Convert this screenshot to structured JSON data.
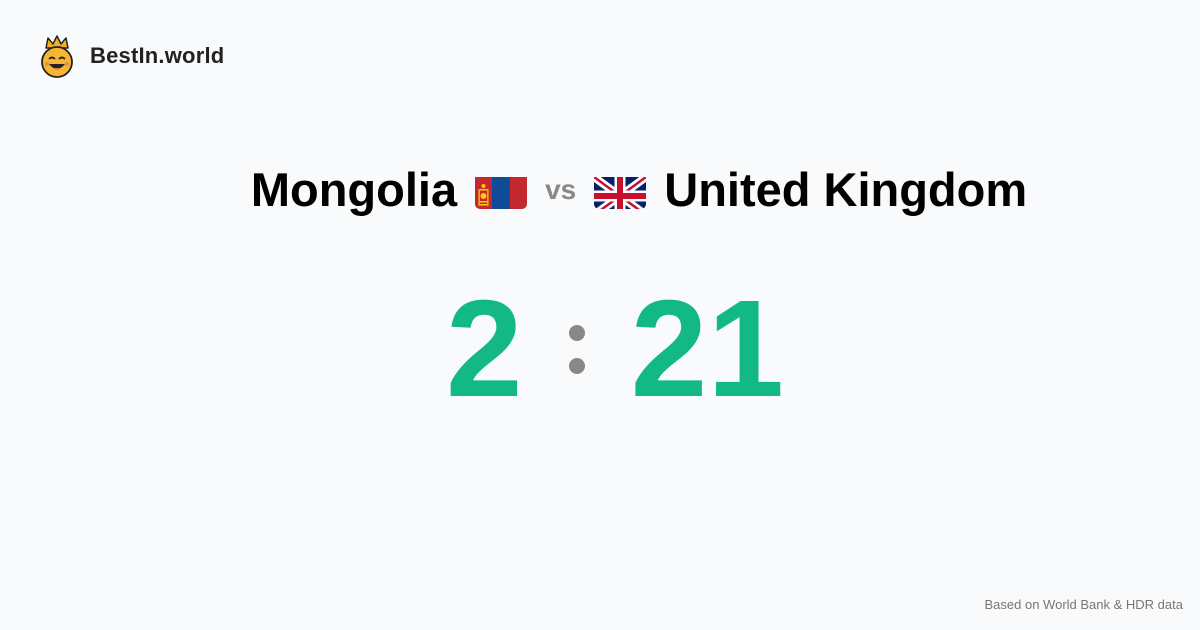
{
  "brand": {
    "name": "BestIn.world",
    "icon": "crowned-smiley-icon"
  },
  "comparison": {
    "left_country": "Mongolia",
    "left_flag": "mongolia-flag-icon",
    "separator": "vs",
    "right_country": "United Kingdom",
    "right_flag": "uk-flag-icon"
  },
  "score": {
    "left": "2",
    "right": "21",
    "color": "#12b886"
  },
  "footer": {
    "source": "Based on World Bank & HDR data"
  }
}
